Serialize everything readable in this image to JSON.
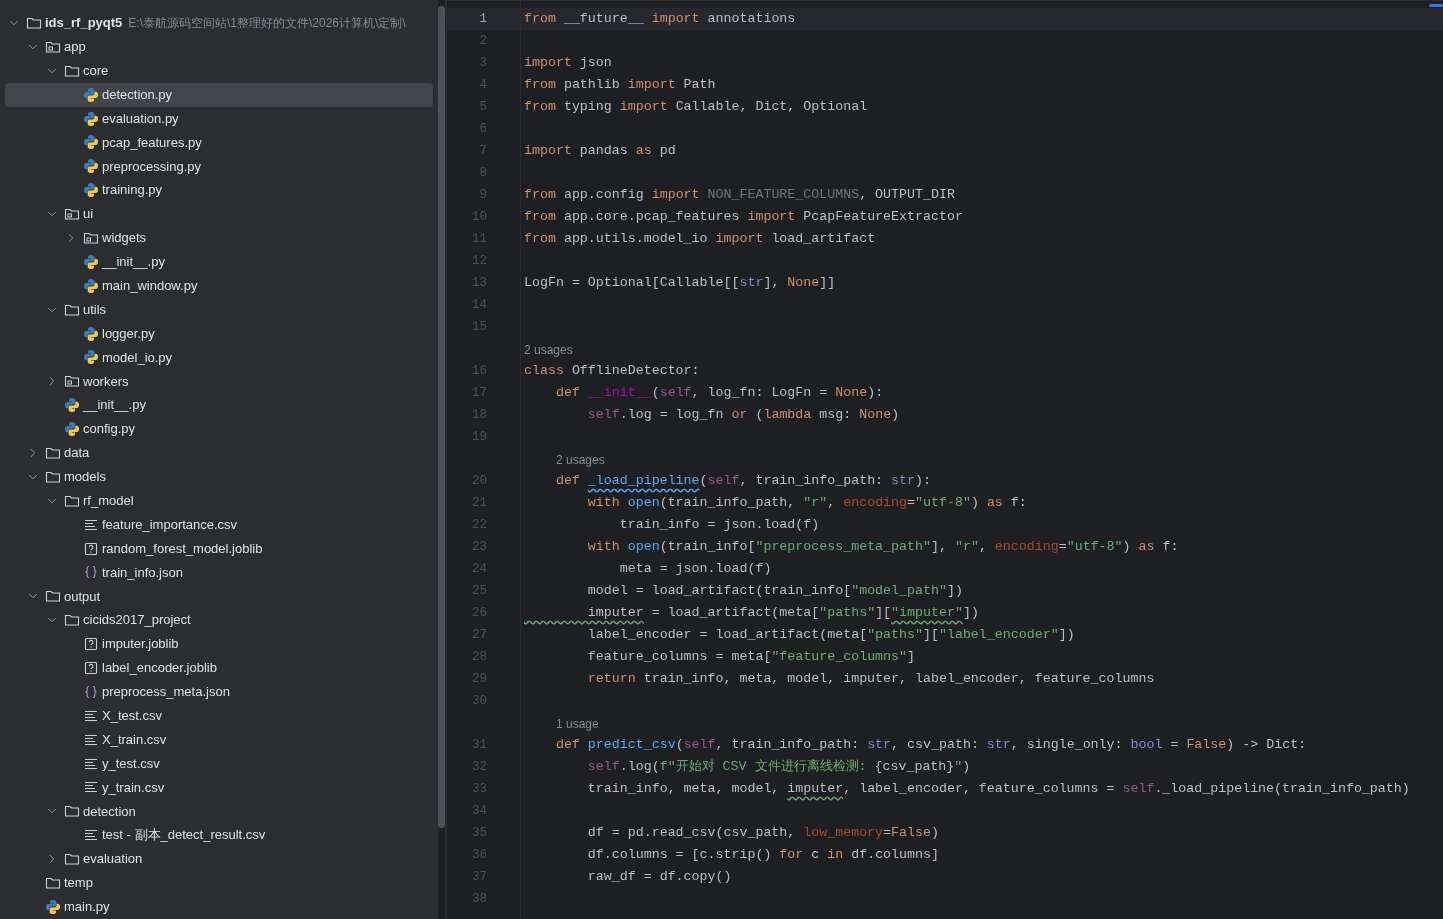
{
  "project_tree": {
    "root": {
      "name": "ids_rf_pyqt5",
      "path": "E:\\泰航源码空间站\\1整理好的文件\\2026计算机\\定制\\",
      "kind": "folder",
      "expanded": true,
      "selected": false,
      "children": [
        {
          "name": "app",
          "kind": "module",
          "expanded": true,
          "selected": false,
          "children": [
            {
              "name": "core",
              "kind": "folder",
              "expanded": true,
              "selected": false,
              "children": [
                {
                  "name": "detection.py",
                  "kind": "python",
                  "selected": true
                },
                {
                  "name": "evaluation.py",
                  "kind": "python",
                  "selected": false
                },
                {
                  "name": "pcap_features.py",
                  "kind": "python",
                  "selected": false
                },
                {
                  "name": "preprocessing.py",
                  "kind": "python",
                  "selected": false
                },
                {
                  "name": "training.py",
                  "kind": "python",
                  "selected": false
                }
              ]
            },
            {
              "name": "ui",
              "kind": "module",
              "expanded": true,
              "selected": false,
              "children": [
                {
                  "name": "widgets",
                  "kind": "module",
                  "expanded": false,
                  "selected": false
                },
                {
                  "name": "__init__.py",
                  "kind": "python",
                  "selected": false
                },
                {
                  "name": "main_window.py",
                  "kind": "python",
                  "selected": false
                }
              ]
            },
            {
              "name": "utils",
              "kind": "folder",
              "expanded": true,
              "selected": false,
              "children": [
                {
                  "name": "logger.py",
                  "kind": "python",
                  "selected": false
                },
                {
                  "name": "model_io.py",
                  "kind": "python",
                  "selected": false
                }
              ]
            },
            {
              "name": "workers",
              "kind": "module",
              "expanded": false,
              "selected": false
            },
            {
              "name": "__init__.py",
              "kind": "python",
              "selected": false
            },
            {
              "name": "config.py",
              "kind": "python",
              "selected": false
            }
          ]
        },
        {
          "name": "data",
          "kind": "folder",
          "expanded": false,
          "selected": false
        },
        {
          "name": "models",
          "kind": "folder",
          "expanded": true,
          "selected": false,
          "children": [
            {
              "name": "rf_model",
              "kind": "folder",
              "expanded": true,
              "selected": false,
              "children": [
                {
                  "name": "feature_importance.csv",
                  "kind": "csv",
                  "selected": false
                },
                {
                  "name": "random_forest_model.joblib",
                  "kind": "binary",
                  "selected": false
                },
                {
                  "name": "train_info.json",
                  "kind": "json",
                  "selected": false
                }
              ]
            }
          ]
        },
        {
          "name": "output",
          "kind": "folder",
          "expanded": true,
          "selected": false,
          "children": [
            {
              "name": "cicids2017_project",
              "kind": "folder",
              "expanded": true,
              "selected": false,
              "children": [
                {
                  "name": "imputer.joblib",
                  "kind": "binary",
                  "selected": false
                },
                {
                  "name": "label_encoder.joblib",
                  "kind": "binary",
                  "selected": false
                },
                {
                  "name": "preprocess_meta.json",
                  "kind": "json",
                  "selected": false
                },
                {
                  "name": "X_test.csv",
                  "kind": "csv",
                  "selected": false
                },
                {
                  "name": "X_train.csv",
                  "kind": "csv",
                  "selected": false
                },
                {
                  "name": "y_test.csv",
                  "kind": "csv",
                  "selected": false
                },
                {
                  "name": "y_train.csv",
                  "kind": "csv",
                  "selected": false
                }
              ]
            },
            {
              "name": "detection",
              "kind": "folder",
              "expanded": true,
              "selected": false,
              "children": [
                {
                  "name": "test - 副本_detect_result.csv",
                  "kind": "csv",
                  "selected": false
                }
              ]
            },
            {
              "name": "evaluation",
              "kind": "folder",
              "expanded": false,
              "selected": false
            }
          ]
        },
        {
          "name": "temp",
          "kind": "folder",
          "selected": false
        },
        {
          "name": "main.py",
          "kind": "python",
          "selected": false
        }
      ]
    }
  },
  "editor": {
    "lines": [
      {
        "no": "1",
        "current": true,
        "tokens": [
          {
            "kind": "k",
            "text": "from"
          },
          {
            "kind": "t",
            "text": " __future__ "
          },
          {
            "kind": "k",
            "text": "import"
          },
          {
            "kind": "t",
            "text": " annotations"
          }
        ]
      },
      {
        "no": "2",
        "current": false
      },
      {
        "no": "3",
        "current": false,
        "tokens": [
          {
            "kind": "k",
            "text": "import"
          },
          {
            "kind": "t",
            "text": " json"
          }
        ]
      },
      {
        "no": "4",
        "current": false,
        "tokens": [
          {
            "kind": "k",
            "text": "from"
          },
          {
            "kind": "t",
            "text": " pathlib "
          },
          {
            "kind": "k",
            "text": "import"
          },
          {
            "kind": "t",
            "text": " Path"
          }
        ]
      },
      {
        "no": "5",
        "current": false,
        "tokens": [
          {
            "kind": "k",
            "text": "from"
          },
          {
            "kind": "t",
            "text": " typing "
          },
          {
            "kind": "k",
            "text": "import"
          },
          {
            "kind": "t",
            "text": " Callable, Dict, Optional"
          }
        ]
      },
      {
        "no": "6",
        "current": false
      },
      {
        "no": "7",
        "current": false,
        "tokens": [
          {
            "kind": "k",
            "text": "import"
          },
          {
            "kind": "t",
            "text": " pandas "
          },
          {
            "kind": "k",
            "text": "as"
          },
          {
            "kind": "t",
            "text": " pd"
          }
        ]
      },
      {
        "no": "8",
        "current": false
      },
      {
        "no": "9",
        "current": false,
        "tokens": [
          {
            "kind": "k",
            "text": "from"
          },
          {
            "kind": "t",
            "text": " app.config "
          },
          {
            "kind": "k",
            "text": "import "
          },
          {
            "kind": "g",
            "text": "NON_FEATURE_COLUMNS"
          },
          {
            "kind": "t",
            "text": ", OUTPUT_DIR"
          }
        ]
      },
      {
        "no": "10",
        "current": false,
        "tokens": [
          {
            "kind": "k",
            "text": "from"
          },
          {
            "kind": "t",
            "text": " app.core.pcap_features "
          },
          {
            "kind": "k",
            "text": "import"
          },
          {
            "kind": "t",
            "text": " PcapFeatureExtractor"
          }
        ]
      },
      {
        "no": "11",
        "current": false,
        "tokens": [
          {
            "kind": "k",
            "text": "from"
          },
          {
            "kind": "t",
            "text": " app.utils.model_io "
          },
          {
            "kind": "k",
            "text": "import"
          },
          {
            "kind": "t",
            "text": " load_artifact"
          }
        ]
      },
      {
        "no": "12",
        "current": false
      },
      {
        "no": "13",
        "current": false,
        "tokens": [
          {
            "kind": "t",
            "text": "LogFn = Optional[Callable[["
          },
          {
            "kind": "b",
            "text": "str"
          },
          {
            "kind": "t",
            "text": "], "
          },
          {
            "kind": "k",
            "text": "None"
          },
          {
            "kind": "t",
            "text": "]]"
          }
        ]
      },
      {
        "no": "14",
        "current": false
      },
      {
        "no": "15",
        "current": false
      },
      {
        "no": "16",
        "current": false,
        "hint": "2 usages",
        "tokens": [
          {
            "kind": "k",
            "text": "class"
          },
          {
            "kind": "t",
            "text": " OfflineDetector:"
          }
        ]
      },
      {
        "no": "17",
        "current": false,
        "tokens": [
          {
            "kind": "k",
            "text": "    def "
          },
          {
            "kind": "d",
            "text": "__init__"
          },
          {
            "kind": "t",
            "text": "("
          },
          {
            "kind": "s",
            "text": "self"
          },
          {
            "kind": "t",
            "text": ", log_fn: LogFn = "
          },
          {
            "kind": "k",
            "text": "None"
          },
          {
            "kind": "t",
            "text": "):"
          }
        ]
      },
      {
        "no": "18",
        "current": false,
        "tokens": [
          {
            "kind": "s",
            "text": "        self"
          },
          {
            "kind": "t",
            "text": ".log = log_fn "
          },
          {
            "kind": "k",
            "text": "or"
          },
          {
            "kind": "t",
            "text": " ("
          },
          {
            "kind": "k",
            "text": "lambda"
          },
          {
            "kind": "t",
            "text": " msg: "
          },
          {
            "kind": "k",
            "text": "None"
          },
          {
            "kind": "t",
            "text": ")"
          }
        ]
      },
      {
        "no": "19",
        "current": false
      },
      {
        "no": "20",
        "current": false,
        "hint": "2 usages",
        "tokens": [
          {
            "kind": "k",
            "text": "    def "
          },
          {
            "kind": "fw",
            "text": "_load_pipeline"
          },
          {
            "kind": "t",
            "text": "("
          },
          {
            "kind": "s",
            "text": "self"
          },
          {
            "kind": "t",
            "text": ", train_info_path: "
          },
          {
            "kind": "b",
            "text": "str"
          },
          {
            "kind": "t",
            "text": "):"
          }
        ]
      },
      {
        "no": "21",
        "current": false,
        "tokens": [
          {
            "kind": "k",
            "text": "        with "
          },
          {
            "kind": "f",
            "text": "open"
          },
          {
            "kind": "t",
            "text": "(train_info_path, "
          },
          {
            "kind": "q",
            "text": "\"r\""
          },
          {
            "kind": "t",
            "text": ", "
          },
          {
            "kind": "p",
            "text": "encoding"
          },
          {
            "kind": "t",
            "text": "="
          },
          {
            "kind": "q",
            "text": "\"utf-8\""
          },
          {
            "kind": "t",
            "text": ") "
          },
          {
            "kind": "k",
            "text": "as"
          },
          {
            "kind": "t",
            "text": " f:"
          }
        ]
      },
      {
        "no": "22",
        "current": false,
        "tokens": [
          {
            "kind": "t",
            "text": "            train_info = json.load(f)"
          }
        ]
      },
      {
        "no": "23",
        "current": false,
        "tokens": [
          {
            "kind": "k",
            "text": "        with "
          },
          {
            "kind": "f",
            "text": "open"
          },
          {
            "kind": "t",
            "text": "(train_info["
          },
          {
            "kind": "q",
            "text": "\"preprocess_meta_path\""
          },
          {
            "kind": "t",
            "text": "], "
          },
          {
            "kind": "q",
            "text": "\"r\""
          },
          {
            "kind": "t",
            "text": ", "
          },
          {
            "kind": "p",
            "text": "encoding"
          },
          {
            "kind": "t",
            "text": "="
          },
          {
            "kind": "q",
            "text": "\"utf-8\""
          },
          {
            "kind": "t",
            "text": ") "
          },
          {
            "kind": "k",
            "text": "as"
          },
          {
            "kind": "t",
            "text": " f:"
          }
        ]
      },
      {
        "no": "24",
        "current": false,
        "tokens": [
          {
            "kind": "t",
            "text": "            meta = json.load(f)"
          }
        ]
      },
      {
        "no": "25",
        "current": false,
        "tokens": [
          {
            "kind": "t",
            "text": "        model = load_artifact(train_info["
          },
          {
            "kind": "q",
            "text": "\"model_path\""
          },
          {
            "kind": "t",
            "text": "])"
          }
        ]
      },
      {
        "no": "26",
        "current": false,
        "tokens": [
          {
            "kind": "w",
            "text": "        imputer"
          },
          {
            "kind": "t",
            "text": " = load_artifact(meta["
          },
          {
            "kind": "q",
            "text": "\"paths\""
          },
          {
            "kind": "t",
            "text": "]["
          },
          {
            "kind": "qw",
            "text": "\"imputer\""
          },
          {
            "kind": "t",
            "text": "])"
          }
        ]
      },
      {
        "no": "27",
        "current": false,
        "tokens": [
          {
            "kind": "t",
            "text": "        label_encoder = load_artifact(meta["
          },
          {
            "kind": "q",
            "text": "\"paths\""
          },
          {
            "kind": "t",
            "text": "]["
          },
          {
            "kind": "q",
            "text": "\"label_encoder\""
          },
          {
            "kind": "t",
            "text": "])"
          }
        ]
      },
      {
        "no": "28",
        "current": false,
        "tokens": [
          {
            "kind": "t",
            "text": "        feature_columns = meta["
          },
          {
            "kind": "q",
            "text": "\"feature_columns\""
          },
          {
            "kind": "t",
            "text": "]"
          }
        ]
      },
      {
        "no": "29",
        "current": false,
        "tokens": [
          {
            "kind": "k",
            "text": "        return"
          },
          {
            "kind": "t",
            "text": " train_info, meta, model, imputer, label_encoder, feature_columns"
          }
        ]
      },
      {
        "no": "30",
        "current": false
      },
      {
        "no": "31",
        "current": false,
        "hint": "1 usage",
        "tokens": [
          {
            "kind": "k",
            "text": "    def "
          },
          {
            "kind": "f",
            "text": "predict_csv"
          },
          {
            "kind": "t",
            "text": "("
          },
          {
            "kind": "s",
            "text": "self"
          },
          {
            "kind": "t",
            "text": ", train_info_path: "
          },
          {
            "kind": "b",
            "text": "str"
          },
          {
            "kind": "t",
            "text": ", csv_path: "
          },
          {
            "kind": "b",
            "text": "str"
          },
          {
            "kind": "t",
            "text": ", single_only: "
          },
          {
            "kind": "b",
            "text": "bool"
          },
          {
            "kind": "t",
            "text": " = "
          },
          {
            "kind": "k",
            "text": "False"
          },
          {
            "kind": "t",
            "text": ") -> Dict:"
          }
        ]
      },
      {
        "no": "32",
        "current": false,
        "tokens": [
          {
            "kind": "s",
            "text": "        self"
          },
          {
            "kind": "t",
            "text": ".log("
          },
          {
            "kind": "q",
            "text": "f\"开始对 CSV 文件进行离线检测: "
          },
          {
            "kind": "t",
            "text": "{csv_path}"
          },
          {
            "kind": "q",
            "text": "\""
          },
          {
            "kind": "t",
            "text": ")"
          }
        ]
      },
      {
        "no": "33",
        "current": false,
        "tokens": [
          {
            "kind": "t",
            "text": "        train_info, meta, model, "
          },
          {
            "kind": "w",
            "text": "imputer"
          },
          {
            "kind": "t",
            "text": ", label_encoder, feature_columns = "
          },
          {
            "kind": "s",
            "text": "self"
          },
          {
            "kind": "t",
            "text": "._load_pipeline(train_info_path)"
          }
        ]
      },
      {
        "no": "34",
        "current": false
      },
      {
        "no": "35",
        "current": false,
        "tokens": [
          {
            "kind": "t",
            "text": "        df = pd.read_csv(csv_path, "
          },
          {
            "kind": "p",
            "text": "low_memory"
          },
          {
            "kind": "t",
            "text": "="
          },
          {
            "kind": "k",
            "text": "False"
          },
          {
            "kind": "t",
            "text": ")"
          }
        ]
      },
      {
        "no": "36",
        "current": false,
        "tokens": [
          {
            "kind": "t",
            "text": "        df.columns = [c.strip() "
          },
          {
            "kind": "k",
            "text": "for"
          },
          {
            "kind": "t",
            "text": " c "
          },
          {
            "kind": "k",
            "text": "in"
          },
          {
            "kind": "t",
            "text": " df.columns]"
          }
        ]
      },
      {
        "no": "37",
        "current": false,
        "tokens": [
          {
            "kind": "t",
            "text": "        raw_df = df.copy()"
          }
        ]
      },
      {
        "no": "38",
        "current": false
      }
    ]
  }
}
